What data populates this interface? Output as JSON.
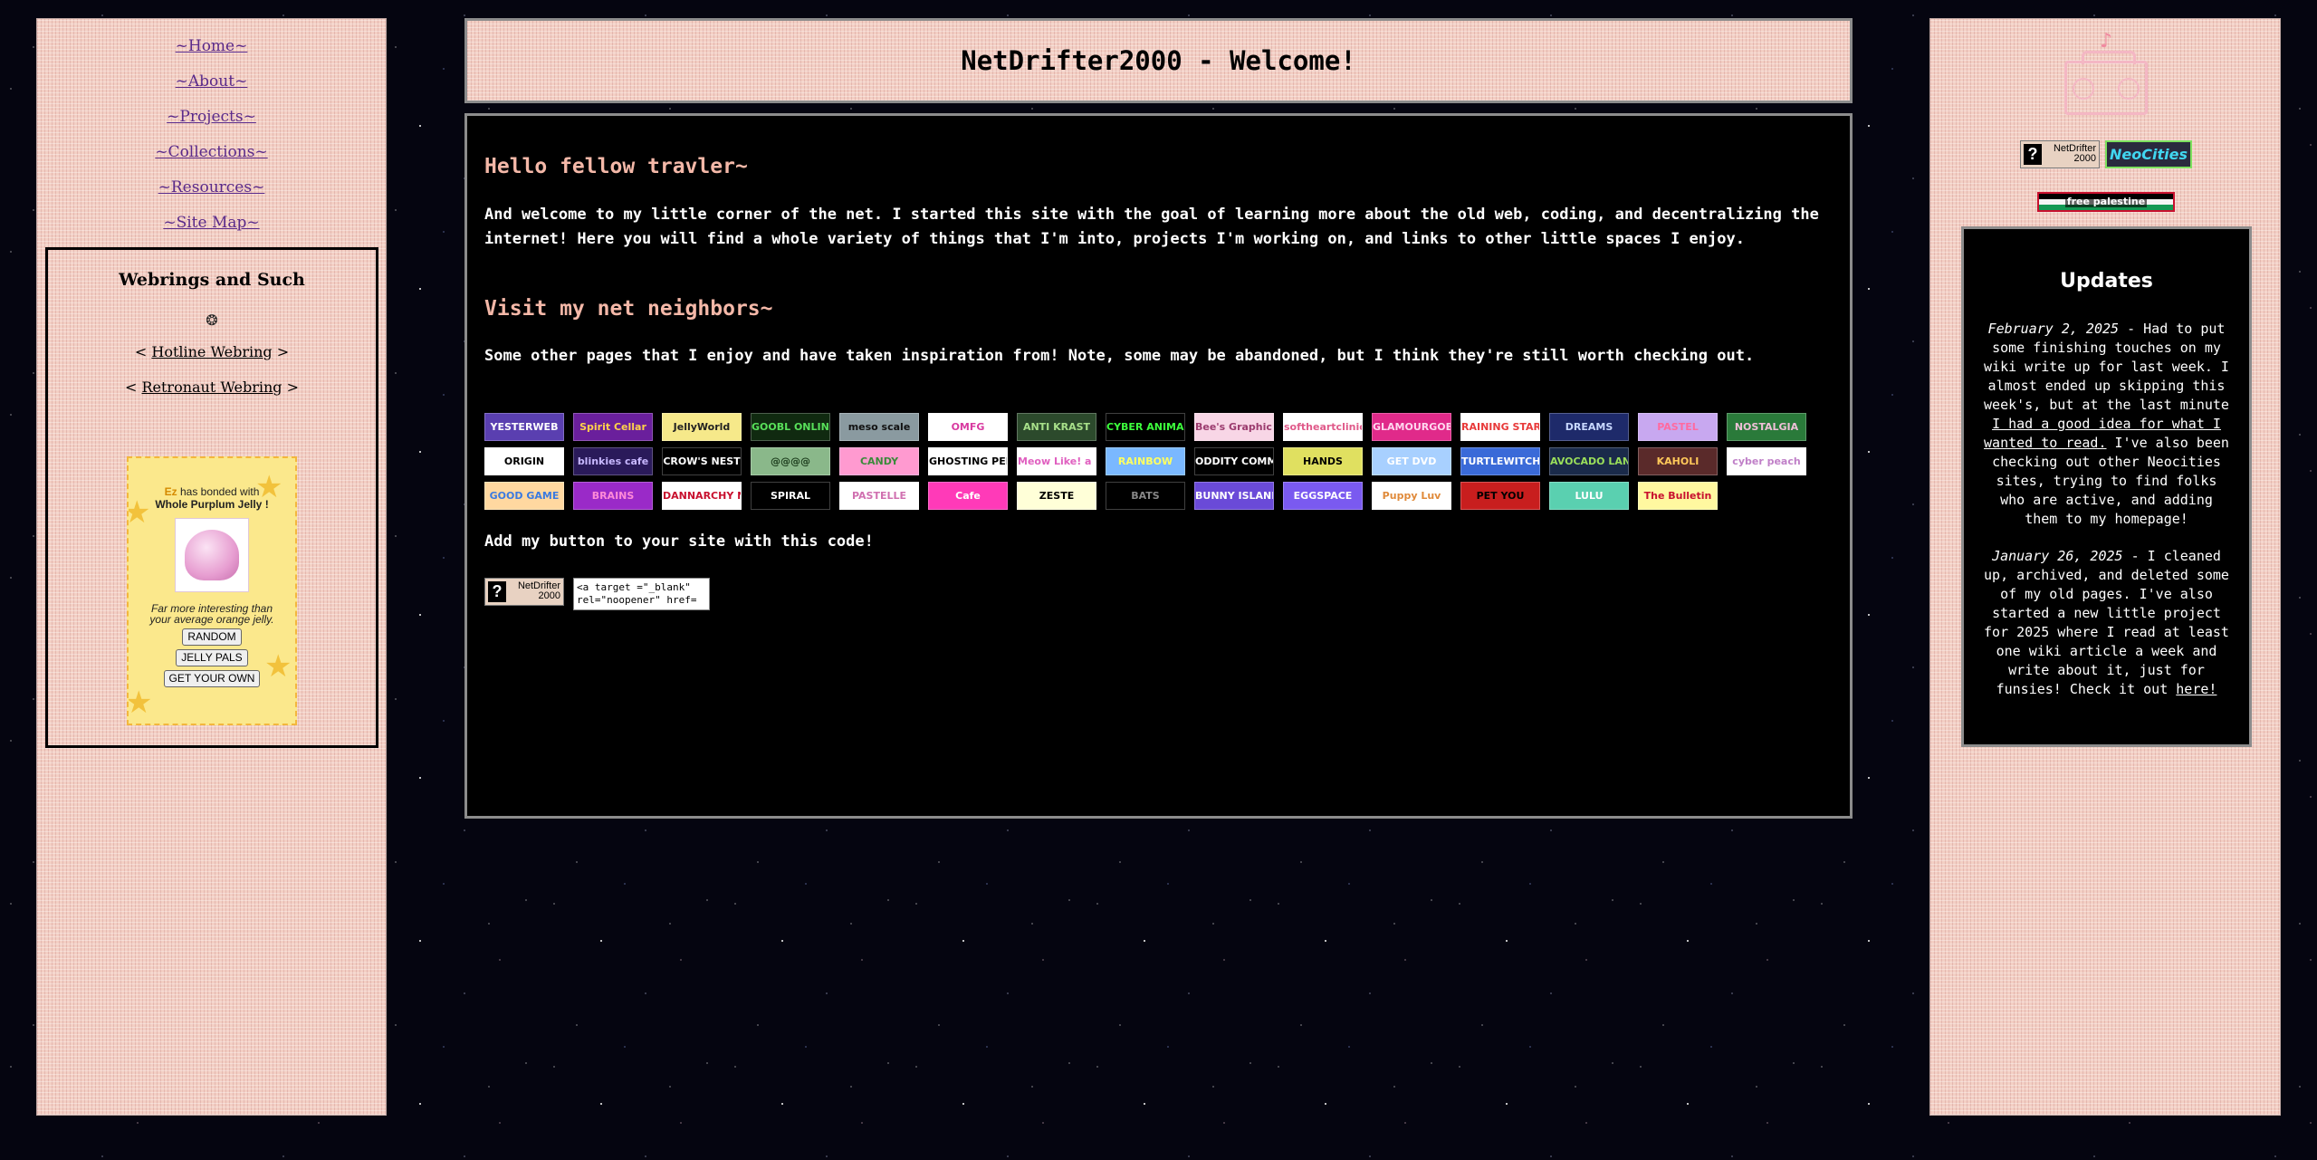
{
  "nav": {
    "links": [
      "~Home~",
      "~About~",
      "~Projects~",
      "~Collections~",
      "~Resources~",
      "~Site Map~"
    ]
  },
  "webrings": {
    "title": "Webrings and Such",
    "ring_icon": "webring-icon",
    "rings": [
      {
        "prev": "<",
        "name": "Hotline Webring",
        "next": ">"
      },
      {
        "prev": "<",
        "name": "Retronaut Webring",
        "next": ">"
      }
    ]
  },
  "jelly": {
    "user": "Ez",
    "bonded_text": "has bonded with",
    "jelly_name": "Whole Purplum Jelly",
    "exclaim": "!",
    "description": "Far more interesting than your average orange jelly.",
    "buttons": [
      "RANDOM",
      "JELLY PALS",
      "GET YOUR OWN"
    ]
  },
  "header": {
    "title": "NetDrifter2000 - Welcome!"
  },
  "main": {
    "hello_heading": "Hello fellow travler~",
    "welcome_text": "And welcome to my little corner of the net. I started this site with the goal of learning more about the old web, coding, and decentralizing the internet! Here you will find a whole variety of things that I'm into, projects I'm working on, and links to other little spaces I enjoy.",
    "neighbors_heading": "Visit my net neighbors~",
    "neighbors_text": "Some other pages that I enjoy and have taken inspiration from! Note, some may be abandoned, but I think they're still worth checking out.",
    "add_button_text": "Add my button to your site with this code!",
    "code_snippet": "<a target =\"_blank\"\nrel=\"noopener\" href=",
    "my_button": {
      "label_top": "NetDrifter",
      "label_bottom": "2000",
      "glyph": "?"
    }
  },
  "neighbor_buttons": [
    {
      "label": "YESTERWEB",
      "bg": "#5a3fb0",
      "fg": "#ffffff"
    },
    {
      "label": "Spirit Cellar",
      "bg": "#6a1f9c",
      "fg": "#ffd24a"
    },
    {
      "label": "JellyWorld",
      "bg": "#f6e98a",
      "fg": "#222222"
    },
    {
      "label": "GOOBL ONLINE",
      "bg": "#102a10",
      "fg": "#58e05a"
    },
    {
      "label": "meso scale",
      "bg": "#8a9aa0",
      "fg": "#111111"
    },
    {
      "label": "OMFG",
      "bg": "#ffffff",
      "fg": "#d83aa0"
    },
    {
      "label": "ANTI KRAST",
      "bg": "#2c4a2c",
      "fg": "#a8e08a"
    },
    {
      "label": "CYBER ANIMALS",
      "bg": "#000000",
      "fg": "#3cff3c"
    },
    {
      "label": "Bee's Graphic Collection",
      "bg": "#f8d6e6",
      "fg": "#9b3b6e"
    },
    {
      "label": "softheartclinic",
      "bg": "#ffffff",
      "fg": "#e05a8a"
    },
    {
      "label": "GLAMOURGOBLIN",
      "bg": "#e02a8a",
      "fg": "#ffd8ef"
    },
    {
      "label": "RAINING STARS",
      "bg": "#ffffff",
      "fg": "#e83a3a"
    },
    {
      "label": "DREAMS",
      "bg": "#1e2a6a",
      "fg": "#c8d8ff"
    },
    {
      "label": "PASTEL",
      "bg": "#c8a8f0",
      "fg": "#ff6aa0"
    },
    {
      "label": "NOSTALGIA",
      "bg": "#2a7a3a",
      "fg": "#f0c0d8"
    },
    {
      "label": "ORIGIN",
      "bg": "#ffffff",
      "fg": "#000000"
    },
    {
      "label": "blinkies cafe",
      "bg": "#2a1a5a",
      "fg": "#c8b8ff"
    },
    {
      "label": "CROW'S NEST",
      "bg": "#000000",
      "fg": "#ffffff"
    },
    {
      "label": "@@@@",
      "bg": "#8ab88a",
      "fg": "#1a3a1a"
    },
    {
      "label": "CANDY",
      "bg": "#ff9ad0",
      "fg": "#3a8a3a"
    },
    {
      "label": "GHOSTING PEN",
      "bg": "#ffffff",
      "fg": "#000000"
    },
    {
      "label": "Meow Like! a Cat",
      "bg": "#ffffff",
      "fg": "#e060c0"
    },
    {
      "label": "RAINBOW",
      "bg": "#7ab8ff",
      "fg": "#ffff60"
    },
    {
      "label": "ODDITY COMMODDITY",
      "bg": "#000000",
      "fg": "#ffffff"
    },
    {
      "label": "HANDS",
      "bg": "#e0e060",
      "fg": "#000000"
    },
    {
      "label": "GET DVD",
      "bg": "#a8d0ff",
      "fg": "#ffffff"
    },
    {
      "label": "TURTLEWITCH",
      "bg": "#3a6ad8",
      "fg": "#ffffff"
    },
    {
      "label": "AVOCADO LAND",
      "bg": "#1a2a4a",
      "fg": "#9adf5a"
    },
    {
      "label": "KAHOLI",
      "bg": "#5a2a2a",
      "fg": "#ffc85a"
    },
    {
      "label": "cyber peach",
      "bg": "#ffffff",
      "fg": "#c080c8"
    },
    {
      "label": "GOOD GAME",
      "bg": "#ffd8a0",
      "fg": "#3a7ae0"
    },
    {
      "label": "BRAINS",
      "bg": "#9a2ac8",
      "fg": "#ff8ad8"
    },
    {
      "label": "DANNARCHY Now!",
      "bg": "#ffffff",
      "fg": "#c8102e"
    },
    {
      "label": "SPIRAL",
      "bg": "#000000",
      "fg": "#ffffff"
    },
    {
      "label": "PASTELLE",
      "bg": "#ffffff",
      "fg": "#d070b0"
    },
    {
      "label": "Cafe",
      "bg": "#ff3ab8",
      "fg": "#ffffff"
    },
    {
      "label": "ZESTE",
      "bg": "#ffffd8",
      "fg": "#000000"
    },
    {
      "label": "BATS",
      "bg": "#000000",
      "fg": "#888888"
    },
    {
      "label": "BUNNY ISLAND",
      "bg": "#6a4ad8",
      "fg": "#ffffff"
    },
    {
      "label": "EGGSPACE",
      "bg": "#7a5af0",
      "fg": "#ffffff"
    },
    {
      "label": "Puppy Luv",
      "bg": "#ffffff",
      "fg": "#e08a3a"
    },
    {
      "label": "PET YOU",
      "bg": "#c81e1e",
      "fg": "#000000"
    },
    {
      "label": "LULU",
      "bg": "#5ad0b0",
      "fg": "#ffffff"
    },
    {
      "label": "The Bulletin",
      "bg": "#fff8a0",
      "fg": "#c8102e"
    }
  ],
  "right": {
    "music_icon": "music-note-icon",
    "boombox_icon": "boombox-icon",
    "btn_netdrifter": {
      "label_top": "NetDrifter",
      "label_bottom": "2000",
      "glyph": "?"
    },
    "btn_neocities": "NeoCities",
    "btn_palestine": "free palestine",
    "updates": {
      "title": "Updates",
      "entries": [
        {
          "date": "February 2, 2025",
          "text_before": " - Had to put some finishing touches on my wiki write up for last week. I almost ended up skipping this week's, but at the last minute ",
          "link": "I had a good idea for what I wanted to read.",
          "text_after": " I've also been checking out other Neocities sites, trying to find folks who are active, and adding them to my homepage!"
        },
        {
          "date": "January 26, 2025",
          "text_before": " - I cleaned up, archived, and deleted some of my old pages. I've also started a new little project for 2025 where I read at least one wiki article a week and write about it, just for funsies! Check it out ",
          "link": "here!",
          "text_after": ""
        }
      ]
    }
  }
}
